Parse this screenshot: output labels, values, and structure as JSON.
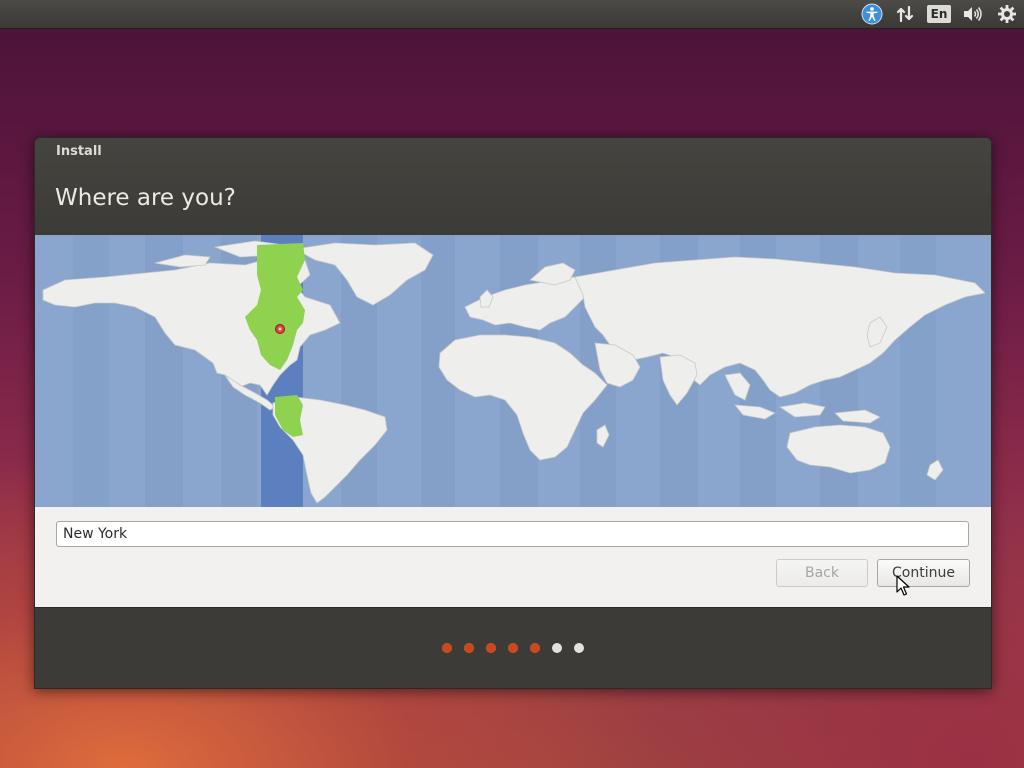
{
  "top_panel": {
    "indicators": [
      {
        "name": "accessibility-icon"
      },
      {
        "name": "network-icon"
      },
      {
        "name": "keyboard-language-icon",
        "label": "En"
      },
      {
        "name": "volume-icon"
      },
      {
        "name": "gear-icon"
      }
    ]
  },
  "window": {
    "title": "Install",
    "page_title": "Where are you?"
  },
  "map": {
    "selected_location": "New York",
    "selected_timezone_color": "#8ed24f",
    "ocean_color": "#8ba6ce",
    "land_color": "#eeeeec"
  },
  "location": {
    "value": "New York"
  },
  "buttons": {
    "back_label": "Back",
    "continue_label": "Continue"
  },
  "progress": {
    "steps_total": 7,
    "steps_completed": 5,
    "completed_color": "#dd4814",
    "pending_color": "#e4e2dc"
  }
}
